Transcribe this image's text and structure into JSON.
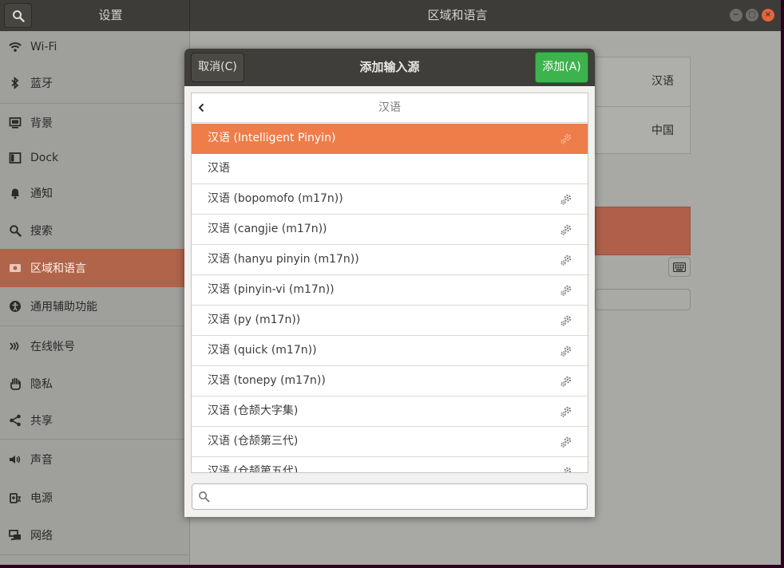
{
  "header": {
    "sidebar_title": "设置",
    "main_title": "区域和语言",
    "window_buttons": {
      "minimize": "−",
      "maximize": "□",
      "close": "×"
    }
  },
  "sidebar": {
    "items": [
      {
        "label": "Wi-Fi",
        "icon": "wifi-icon"
      },
      {
        "label": "蓝牙",
        "icon": "bluetooth-icon"
      },
      {
        "label": "背景",
        "icon": "background-icon"
      },
      {
        "label": "Dock",
        "icon": "dock-icon"
      },
      {
        "label": "通知",
        "icon": "bell-icon"
      },
      {
        "label": "搜索",
        "icon": "search-icon"
      },
      {
        "label": "区域和语言",
        "icon": "flag-icon",
        "active": true
      },
      {
        "label": "通用辅助功能",
        "icon": "accessibility-icon"
      },
      {
        "label": "在线帐号",
        "icon": "online-accounts-icon"
      },
      {
        "label": "隐私",
        "icon": "hand-icon"
      },
      {
        "label": "共享",
        "icon": "share-icon"
      },
      {
        "label": "声音",
        "icon": "speaker-icon"
      },
      {
        "label": "电源",
        "icon": "power-icon"
      },
      {
        "label": "网络",
        "icon": "network-icon"
      }
    ]
  },
  "main": {
    "language_value": "汉语",
    "formats_value": "中国"
  },
  "dialog": {
    "cancel_label": "取消(C)",
    "title": "添加输入源",
    "add_label": "添加(A)",
    "list_title": "汉语",
    "items": [
      {
        "label": "汉语 (Intelligent Pinyin)",
        "has_settings": true,
        "selected": true
      },
      {
        "label": "汉语",
        "has_settings": false
      },
      {
        "label": "汉语 (bopomofo (m17n))",
        "has_settings": true
      },
      {
        "label": "汉语 (cangjie (m17n))",
        "has_settings": true
      },
      {
        "label": "汉语 (hanyu pinyin (m17n))",
        "has_settings": true
      },
      {
        "label": "汉语 (pinyin-vi (m17n))",
        "has_settings": true
      },
      {
        "label": "汉语 (py (m17n))",
        "has_settings": true
      },
      {
        "label": "汉语 (quick (m17n))",
        "has_settings": true
      },
      {
        "label": "汉语 (tonepy (m17n))",
        "has_settings": true
      },
      {
        "label": "汉语 (仓颉大字集)",
        "has_settings": true
      },
      {
        "label": "汉语 (仓颉第三代)",
        "has_settings": true
      },
      {
        "label": "汉语 (仓颉第五代)",
        "has_settings": true
      }
    ],
    "search_value": "",
    "search_placeholder": ""
  },
  "colors": {
    "accent": "#ee7d4a",
    "add_button": "#3cb34c",
    "headerbar": "#3d3c38"
  }
}
